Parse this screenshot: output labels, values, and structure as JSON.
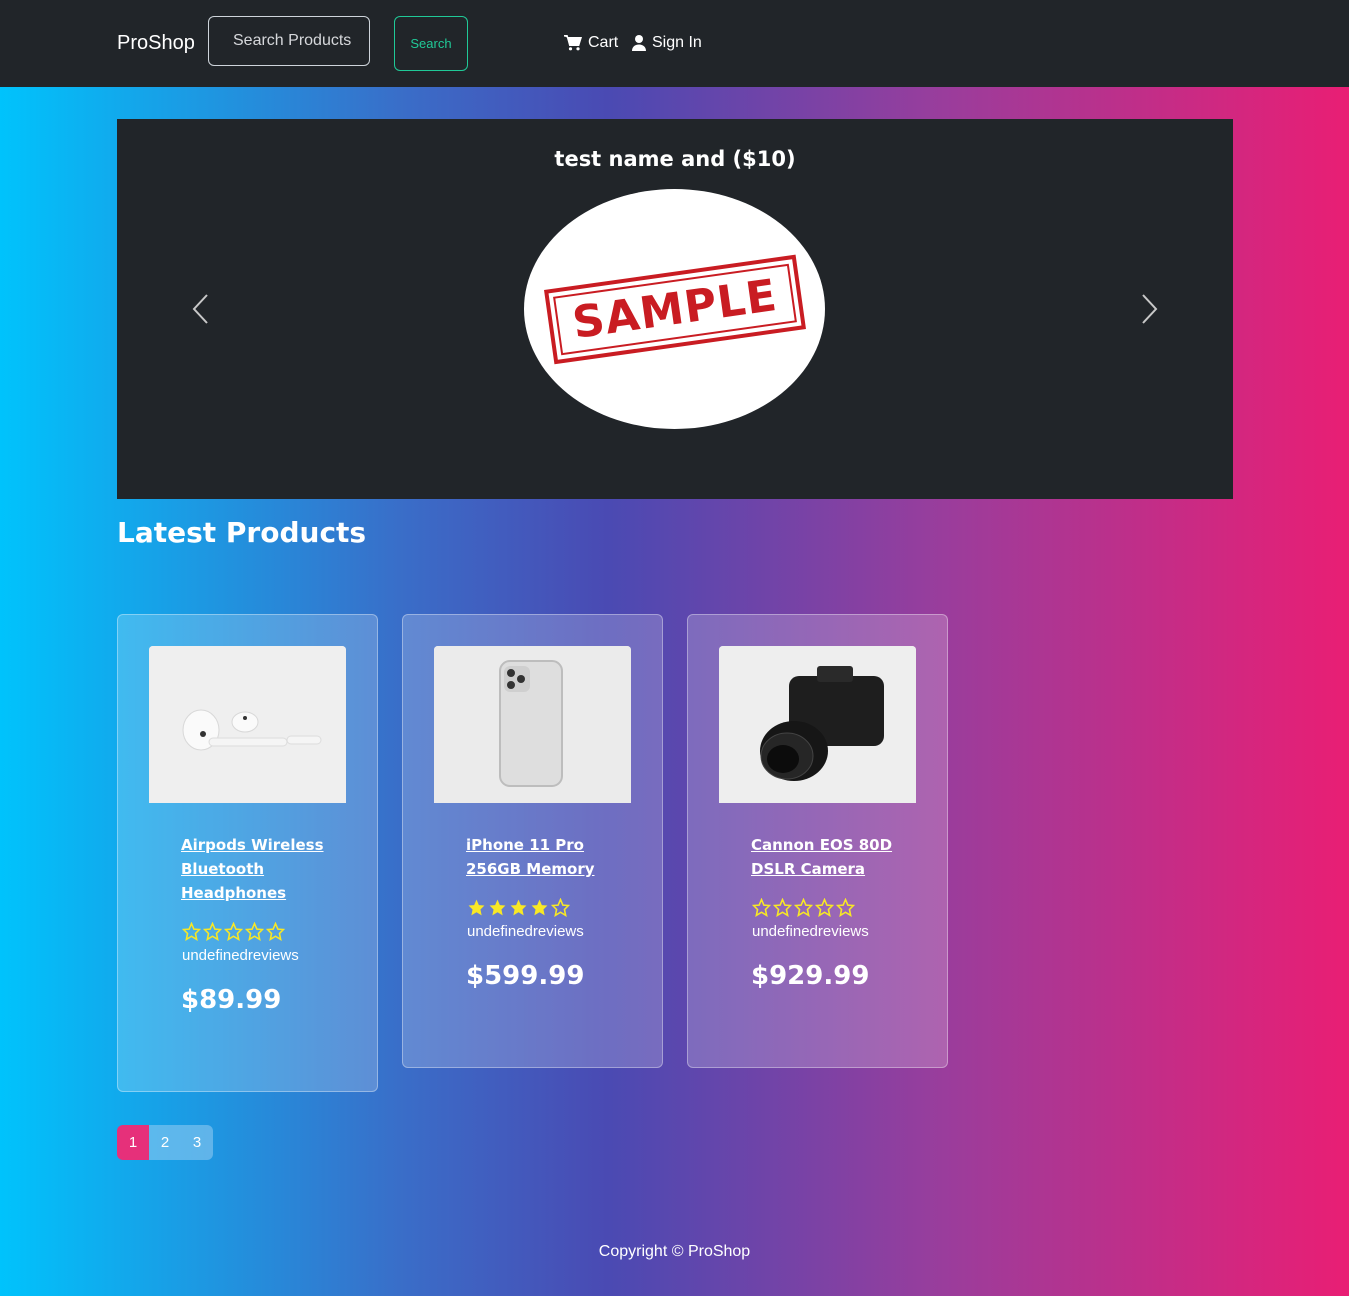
{
  "header": {
    "brand": "ProShop",
    "search": {
      "placeholder": "Search Products"
    },
    "search_button": "Search",
    "nav": {
      "cart": "Cart",
      "sign_in": "Sign In"
    },
    "accent": "#20c997"
  },
  "carousel": {
    "caption": "test name and ($10)",
    "image_label": "SAMPLE",
    "prev_icon": "chevron-left-icon",
    "next_icon": "chevron-right-icon"
  },
  "main": {
    "title": "Latest Products",
    "products": [
      {
        "name": "Airpods Wireless Bluetooth Headphones",
        "rating": 0,
        "reviews": "undefinedreviews",
        "price": "$89.99"
      },
      {
        "name": "iPhone 11 Pro 256GB Memory",
        "rating": 4,
        "reviews": "undefinedreviews",
        "price": "$599.99"
      },
      {
        "name": "Cannon EOS 80D DSLR Camera",
        "rating": 0,
        "reviews": "undefinedreviews",
        "price": "$929.99"
      }
    ],
    "pagination": {
      "pages": [
        "1",
        "2",
        "3"
      ],
      "active": "1",
      "active_color": "#e6307a"
    }
  },
  "footer": {
    "text": "Copyright © ProShop"
  },
  "colors": {
    "star": "#f8e825",
    "navbar": "#212529"
  }
}
